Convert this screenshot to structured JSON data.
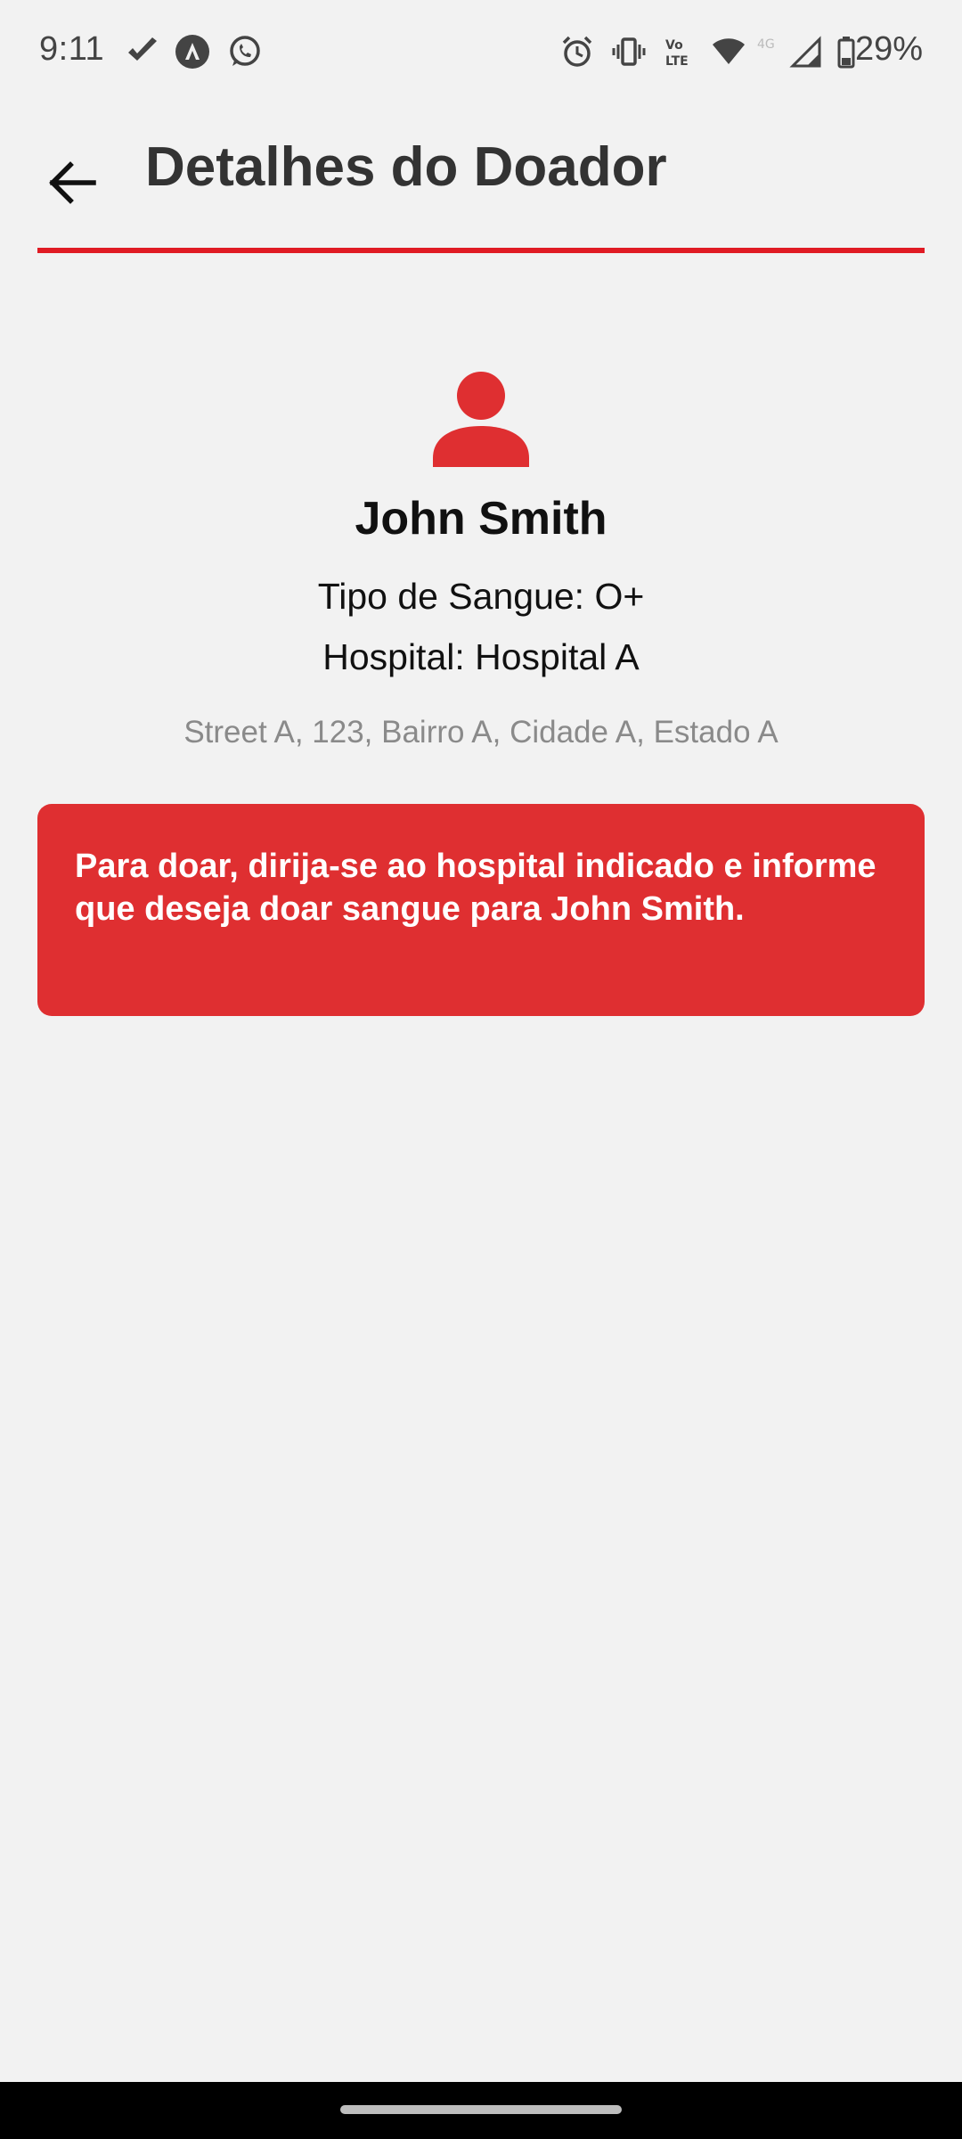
{
  "status_bar": {
    "time": "9:11",
    "battery": "29%",
    "icons": [
      "check-icon",
      "app-icon",
      "whatsapp-icon",
      "alarm-icon",
      "vibrate-icon",
      "volte-icon",
      "wifi-icon",
      "signal-icon",
      "battery-icon"
    ]
  },
  "header": {
    "title": "Detalhes do Doador",
    "accent_color": "#e01b24"
  },
  "donor": {
    "name": "John Smith",
    "blood_type": "Tipo de Sangue: O+",
    "hospital": "Hospital: Hospital A",
    "address": "Street A, 123, Bairro A, Cidade A, Estado A"
  },
  "info_card": {
    "message": "Para doar, dirija-se ao hospital indicado e informe que deseja doar sangue para John Smith.",
    "background_color": "#df2f31"
  }
}
